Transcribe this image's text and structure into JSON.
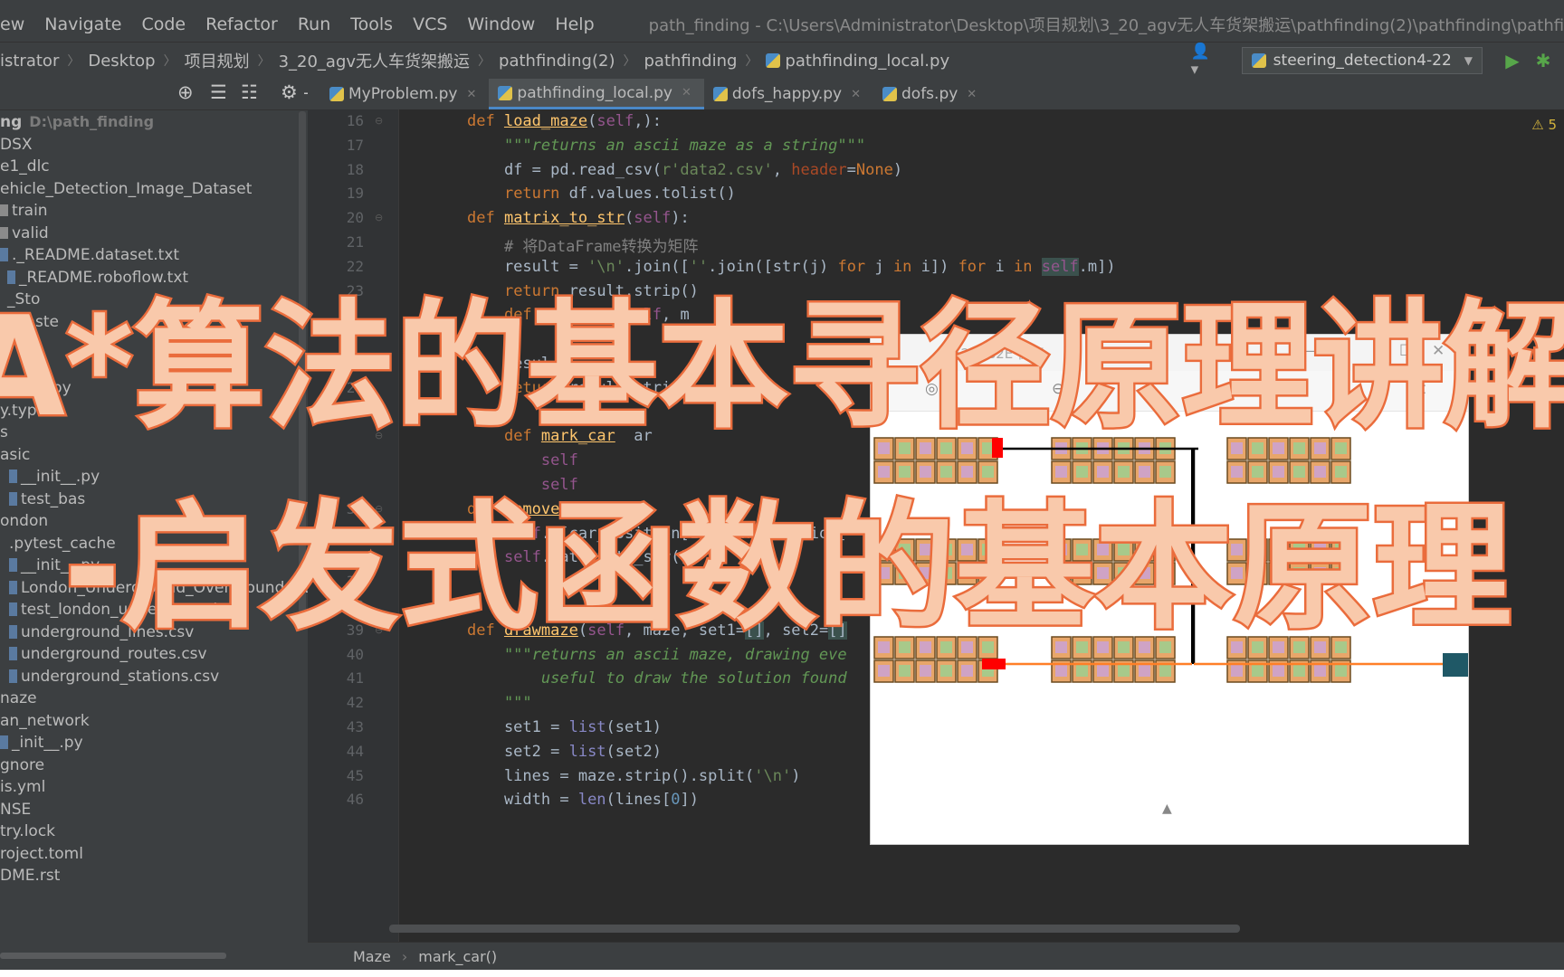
{
  "menu": {
    "items": [
      "ew",
      "Navigate",
      "Code",
      "Refactor",
      "Run",
      "Tools",
      "VCS",
      "Window",
      "Help"
    ],
    "window_title": "path_finding - C:\\Users\\Administrator\\Desktop\\项目规划\\3_20_agv无人车货架搬运\\pathfinding(2)\\pathfinding\\pathfinding_local.py"
  },
  "breadcrumb": [
    "istrator",
    "Desktop",
    "项目规划",
    "3_20_agv无人车货架搬运",
    "pathfinding(2)",
    "pathfinding",
    "pathfinding_local.py"
  ],
  "toolbar": {
    "run_config": "steering_detection4-22",
    "icons": [
      "user-icon",
      "run-icon",
      "debug-icon"
    ]
  },
  "project": {
    "root_name": "ng",
    "root_path": "D:\\path_finding",
    "items": [
      "DSX",
      "e1_dlc",
      "ehicle_Detection_Image_Dataset",
      "train",
      "valid",
      "._README.dataset.txt",
      "_README.roboflow.txt",
      "_Sto",
      "r-maste",
      "",
      "",
      "_init__.py",
      "y.typed",
      "s",
      "asic",
      "__init__.py",
      "test_bas",
      "ondon",
      ".pytest_cache",
      "__init__.py",
      "London_Underground_Overground_DLR_Cros",
      "test_london_underground.py",
      "underground_lines.csv",
      "underground_routes.csv",
      "underground_stations.csv",
      "naze",
      "an_network",
      "_init__.py",
      "gnore",
      "is.yml",
      "NSE",
      "try.lock",
      "roject.toml",
      "DME.rst"
    ]
  },
  "tabs": [
    {
      "label": "MyProblem.py",
      "active": false
    },
    {
      "label": "pathfinding_local.py",
      "active": true
    },
    {
      "label": "dofs_happy.py",
      "active": false
    },
    {
      "label": "dofs.py",
      "active": false
    }
  ],
  "editor": {
    "warnings": "5",
    "line_numbers": [
      "16",
      "17",
      "18",
      "19",
      "20",
      "21",
      "22",
      "23",
      "",
      "",
      "27",
      "28",
      "",
      "",
      "",
      "",
      "34",
      "35",
      "36",
      "37",
      "38",
      "39",
      "40",
      "41",
      "42",
      "43",
      "44",
      "45",
      "46"
    ],
    "code": [
      [
        {
          "t": "def ",
          "c": "kw"
        },
        {
          "t": "load_maze",
          "c": "fn"
        },
        {
          "t": "(",
          "c": "p"
        },
        {
          "t": "self",
          "c": "self"
        },
        {
          "t": ",):",
          "c": "p"
        }
      ],
      [
        {
          "t": "    \"\"\"returns an ascii maze as a string\"\"\"",
          "c": "doc"
        }
      ],
      [
        {
          "t": "    df = pd.read_csv(",
          "c": "p"
        },
        {
          "t": "r'data2.csv'",
          "c": "str"
        },
        {
          "t": ", ",
          "c": "p"
        },
        {
          "t": "header",
          "c": "param"
        },
        {
          "t": "=",
          "c": "p"
        },
        {
          "t": "None",
          "c": "kw"
        },
        {
          "t": ")",
          "c": "p"
        }
      ],
      [
        {
          "t": "    ",
          "c": "p"
        },
        {
          "t": "return ",
          "c": "kw"
        },
        {
          "t": "df.values.tolist()",
          "c": "p"
        }
      ],
      [
        {
          "t": "def ",
          "c": "kw"
        },
        {
          "t": "matrix_to_str",
          "c": "fn"
        },
        {
          "t": "(",
          "c": "p"
        },
        {
          "t": "self",
          "c": "self"
        },
        {
          "t": "):",
          "c": "p"
        }
      ],
      [
        {
          "t": "    # 将DataFrame转换为矩阵",
          "c": "cm"
        }
      ],
      [
        {
          "t": "    result = ",
          "c": "p"
        },
        {
          "t": "'\\n'",
          "c": "str"
        },
        {
          "t": ".join([",
          "c": "p"
        },
        {
          "t": "''",
          "c": "str"
        },
        {
          "t": ".join([str(j) ",
          "c": "p"
        },
        {
          "t": "for ",
          "c": "kw"
        },
        {
          "t": "j ",
          "c": "p"
        },
        {
          "t": "in ",
          "c": "kw"
        },
        {
          "t": "i]) ",
          "c": "p"
        },
        {
          "t": "for ",
          "c": "kw"
        },
        {
          "t": "i ",
          "c": "p"
        },
        {
          "t": "in ",
          "c": "kw"
        },
        {
          "t": "self",
          "c": "selfhl"
        },
        {
          "t": ".m])",
          "c": "p"
        }
      ],
      [
        {
          "t": "    ",
          "c": "p"
        },
        {
          "t": "return ",
          "c": "kw"
        },
        {
          "t": "result.strip()",
          "c": "p"
        }
      ],
      [
        {
          "t": "    ",
          "c": "p"
        },
        {
          "t": "def ",
          "c": "kw"
        },
        {
          "t": "r_t",
          "c": "fn"
        },
        {
          "t": "      ",
          "c": "p"
        },
        {
          "t": "self",
          "c": "self"
        },
        {
          "t": ", m",
          "c": "p"
        }
      ],
      [
        {
          "t": "    ",
          "c": "p"
        }
      ],
      [
        {
          "t": "    resul",
          "c": "p"
        }
      ],
      [
        {
          "t": "    ",
          "c": "p"
        },
        {
          "t": "return ",
          "c": "kw"
        },
        {
          "t": "result.strip()",
          "c": "p"
        }
      ],
      [
        {
          "t": "    ",
          "c": "p"
        }
      ],
      [
        {
          "t": "    ",
          "c": "p"
        },
        {
          "t": "def ",
          "c": "kw"
        },
        {
          "t": "mark_car",
          "c": "fn"
        },
        {
          "t": "  ar",
          "c": "p"
        }
      ],
      [
        {
          "t": "        ",
          "c": "p"
        },
        {
          "t": "self",
          "c": "self"
        }
      ],
      [
        {
          "t": "        ",
          "c": "p"
        },
        {
          "t": "self",
          "c": "self"
        }
      ],
      [
        {
          "t": "def ",
          "c": "kw"
        },
        {
          "t": "remove_",
          "c": "fn"
        }
      ],
      [
        {
          "t": "    ",
          "c": "p"
        },
        {
          "t": "self",
          "c": "self"
        },
        {
          "t": ".m[car_position[1]][car_position[",
          "c": "p"
        }
      ],
      [
        {
          "t": "    ",
          "c": "p"
        },
        {
          "t": "self",
          "c": "self"
        },
        {
          "t": ".matrix_to_str()",
          "c": "p"
        }
      ],
      [
        {
          "t": "",
          "c": "p"
        }
      ],
      [
        {
          "t": "",
          "c": "p"
        }
      ],
      [
        {
          "t": "def ",
          "c": "kw"
        },
        {
          "t": "drawmaze",
          "c": "fn"
        },
        {
          "t": "(",
          "c": "p"
        },
        {
          "t": "self",
          "c": "self"
        },
        {
          "t": ", maze, set1=",
          "c": "p"
        },
        {
          "t": "[]",
          "c": "hl"
        },
        {
          "t": ", set2=",
          "c": "p"
        },
        {
          "t": "[]",
          "c": "hl"
        }
      ],
      [
        {
          "t": "    \"\"\"returns an ascii maze, drawing eve",
          "c": "doc"
        }
      ],
      [
        {
          "t": "        useful to draw the solution found",
          "c": "doc"
        }
      ],
      [
        {
          "t": "    \"\"\"",
          "c": "doc"
        }
      ],
      [
        {
          "t": "    set1 = ",
          "c": "p"
        },
        {
          "t": "list",
          "c": "builtin"
        },
        {
          "t": "(set1)",
          "c": "p"
        }
      ],
      [
        {
          "t": "    set2 = ",
          "c": "p"
        },
        {
          "t": "list",
          "c": "builtin"
        },
        {
          "t": "(set2)",
          "c": "p"
        }
      ],
      [
        {
          "t": "    lines = maze.strip().split(",
          "c": "p"
        },
        {
          "t": "'\\n'",
          "c": "str"
        },
        {
          "t": ")",
          "c": "p"
        }
      ],
      [
        {
          "t": "    width = ",
          "c": "p"
        },
        {
          "t": "len",
          "c": "builtin"
        },
        {
          "t": "(lines[",
          "c": "p"
        },
        {
          "t": "0",
          "c": "num"
        },
        {
          "t": "])",
          "c": "p"
        }
      ]
    ]
  },
  "status": {
    "items": [
      "Maze",
      "mark_car()"
    ]
  },
  "popup": {
    "title_fragment": "52  K/S2E  像素",
    "window_controls": [
      "—",
      "☐",
      "─",
      "☐",
      "✕"
    ],
    "icons": [
      "target-icon",
      "split-icon",
      "rotate-icon",
      "crop-icon"
    ],
    "shelf_color": "#e8a66a",
    "path_color": "#000000",
    "route_color": "#ff7f27",
    "car_color": "#ff0000",
    "goal_color": "#1f5866"
  },
  "headline": {
    "line1": "A*算法的基本寻径原理讲解",
    "line2": "-启发式函数的基本原理",
    "fill_color": "#f9c9ab",
    "outline_color": "#ea6c3c"
  }
}
